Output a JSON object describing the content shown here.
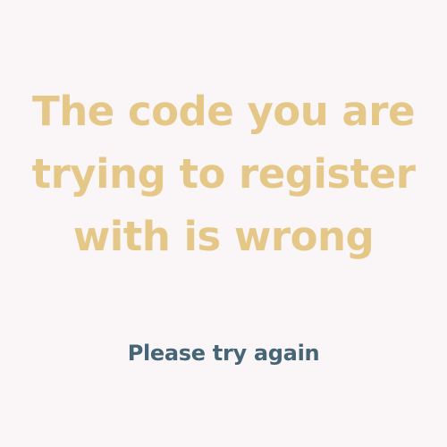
{
  "message": {
    "headline_lines": [
      "The code you are",
      "trying to register",
      "with is wrong"
    ],
    "subline": "Please try again"
  },
  "colors": {
    "background": "#faf6f7",
    "headline": "#e5c888",
    "subline": "#466577"
  }
}
